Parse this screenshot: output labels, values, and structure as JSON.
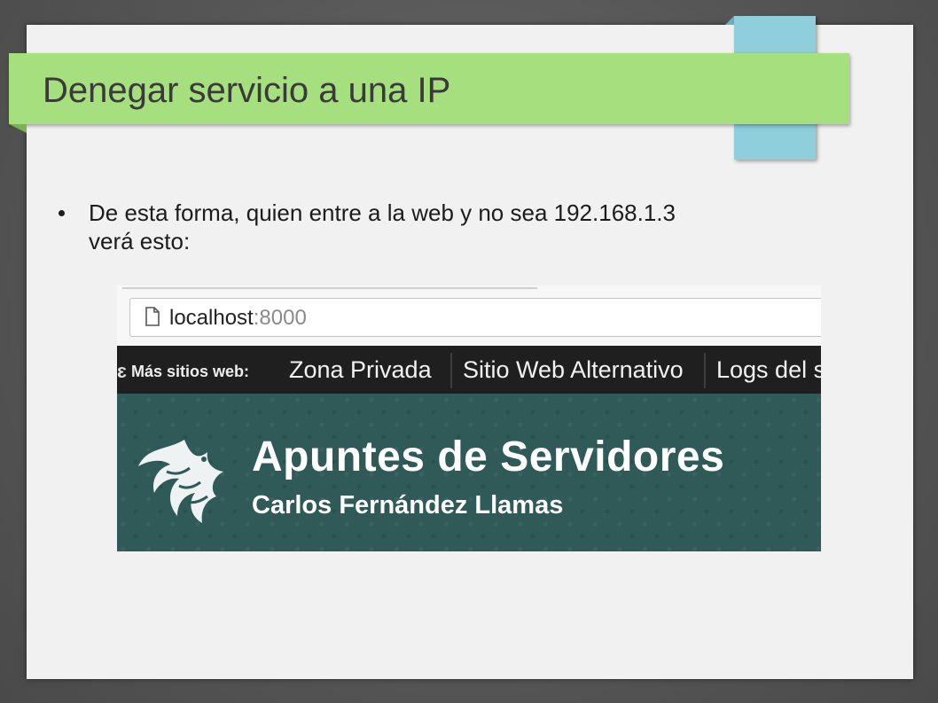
{
  "slide": {
    "title": "Denegar servicio a una IP",
    "bullets": [
      {
        "line1": "De esta forma, quien entre a la web y no sea 192.168.1.3",
        "line2": "verá esto:"
      }
    ]
  },
  "screenshot": {
    "browser": {
      "url_host": "localhost",
      "url_port": ":8000",
      "page_icon": "page-icon"
    },
    "nav": {
      "edge_glyph": "ɛ",
      "label": "Más sitios web:",
      "links": [
        "Zona Privada",
        "Sitio Web Alternativo",
        "Logs del s"
      ]
    },
    "hero": {
      "title": "Apuntes de Servidores",
      "subtitle": "Carlos Fernández Llamas",
      "logo": "dragon-logo"
    }
  },
  "colors": {
    "title_band": "#a6df7e",
    "blue_tab": "#8fcfdc",
    "hero_bg": "#2f5a58",
    "nav_bg": "#1f1f1f"
  }
}
